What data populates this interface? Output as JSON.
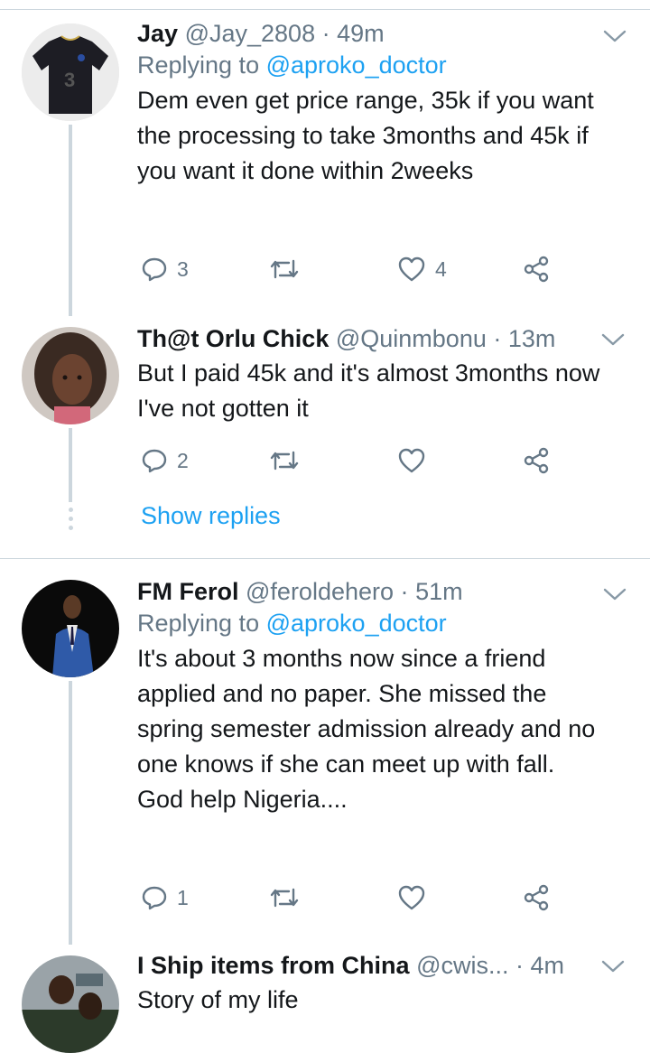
{
  "tweets": [
    {
      "name": "Jay",
      "handle": "@Jay_2808",
      "sep": "·",
      "time": "49m",
      "replying_label": "Replying to",
      "replying_to": "@aproko_doctor",
      "text": "Dem even get price range, 35k if you want the processing to take 3months and 45k if you want it done within 2weeks",
      "reply_count": "3",
      "retweet_count": "",
      "like_count": "4"
    },
    {
      "name": "Th@t Orlu Chick",
      "handle": "@Quinmbonu",
      "sep": "·",
      "time": "13m",
      "text": "But I paid 45k and it's almost 3months now I've not gotten it",
      "reply_count": "2",
      "retweet_count": "",
      "like_count": ""
    },
    {
      "name": "FM Ferol",
      "handle": "@feroldehero",
      "sep": "·",
      "time": "51m",
      "replying_label": "Replying to",
      "replying_to": "@aproko_doctor",
      "text": "It's about 3 months now since a friend applied and no paper. She missed the spring semester admission already and no one knows if she can meet up with fall.\nGod help Nigeria....",
      "reply_count": "1",
      "retweet_count": "",
      "like_count": ""
    },
    {
      "name": "I Ship items from China",
      "handle": "@cwis...",
      "sep": "·",
      "time": "4m",
      "text": "Story of my life"
    }
  ],
  "show_replies": "Show replies",
  "colors": {
    "link": "#1da1f2",
    "muted": "#657786",
    "text": "#14171a",
    "divider": "#ccd6dd"
  },
  "icons": [
    "chevron-down-icon",
    "reply-icon",
    "retweet-icon",
    "like-icon",
    "share-icon"
  ]
}
